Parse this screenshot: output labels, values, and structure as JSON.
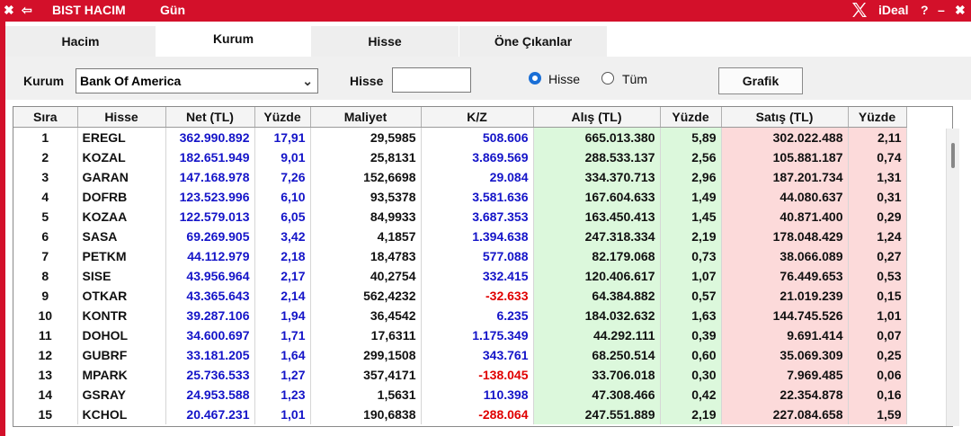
{
  "titlebar": {
    "close_glyph": "✖",
    "back_glyph": "⇦",
    "title": "BIST HACIM",
    "subtitle": "Gün",
    "brand": "iDeal",
    "help": "?",
    "minimize": "–",
    "close_right": "✖"
  },
  "tabs": [
    {
      "label": "Hacim",
      "active": false
    },
    {
      "label": "Kurum",
      "active": true
    },
    {
      "label": "Hisse",
      "active": false
    },
    {
      "label": "Öne Çıkanlar",
      "active": false
    }
  ],
  "toolbar": {
    "kurum_label": "Kurum",
    "kurum_value": "Bank Of America",
    "hisse_label": "Hisse",
    "hisse_value": "",
    "radio_hisse": "Hisse",
    "radio_tum": "Tüm",
    "selected_radio": "Hisse",
    "grafik_button": "Grafik"
  },
  "table": {
    "columns": [
      "Sıra",
      "Hisse",
      "Net (TL)",
      "Yüzde",
      "Maliyet",
      "K/Z",
      "Alış (TL)",
      "Yüzde",
      "Satış (TL)",
      "Yüzde"
    ],
    "rows": [
      [
        "1",
        "EREGL",
        "362.990.892",
        "17,91",
        "29,5985",
        "508.606",
        "665.013.380",
        "5,89",
        "302.022.488",
        "2,11"
      ],
      [
        "2",
        "KOZAL",
        "182.651.949",
        "9,01",
        "25,8131",
        "3.869.569",
        "288.533.137",
        "2,56",
        "105.881.187",
        "0,74"
      ],
      [
        "3",
        "GARAN",
        "147.168.978",
        "7,26",
        "152,6698",
        "29.084",
        "334.370.713",
        "2,96",
        "187.201.734",
        "1,31"
      ],
      [
        "4",
        "DOFRB",
        "123.523.996",
        "6,10",
        "93,5378",
        "3.581.636",
        "167.604.633",
        "1,49",
        "44.080.637",
        "0,31"
      ],
      [
        "5",
        "KOZAA",
        "122.579.013",
        "6,05",
        "84,9933",
        "3.687.353",
        "163.450.413",
        "1,45",
        "40.871.400",
        "0,29"
      ],
      [
        "6",
        "SASA",
        "69.269.905",
        "3,42",
        "4,1857",
        "1.394.638",
        "247.318.334",
        "2,19",
        "178.048.429",
        "1,24"
      ],
      [
        "7",
        "PETKM",
        "44.112.979",
        "2,18",
        "18,4783",
        "577.088",
        "82.179.068",
        "0,73",
        "38.066.089",
        "0,27"
      ],
      [
        "8",
        "SISE",
        "43.956.964",
        "2,17",
        "40,2754",
        "332.415",
        "120.406.617",
        "1,07",
        "76.449.653",
        "0,53"
      ],
      [
        "9",
        "OTKAR",
        "43.365.643",
        "2,14",
        "562,4232",
        "-32.633",
        "64.384.882",
        "0,57",
        "21.019.239",
        "0,15"
      ],
      [
        "10",
        "KONTR",
        "39.287.106",
        "1,94",
        "36,4542",
        "6.235",
        "184.032.632",
        "1,63",
        "144.745.526",
        "1,01"
      ],
      [
        "11",
        "DOHOL",
        "34.600.697",
        "1,71",
        "17,6311",
        "1.175.349",
        "44.292.111",
        "0,39",
        "9.691.414",
        "0,07"
      ],
      [
        "12",
        "GUBRF",
        "33.181.205",
        "1,64",
        "299,1508",
        "343.761",
        "68.250.514",
        "0,60",
        "35.069.309",
        "0,25"
      ],
      [
        "13",
        "MPARK",
        "25.736.533",
        "1,27",
        "357,4171",
        "-138.045",
        "33.706.018",
        "0,30",
        "7.969.485",
        "0,06"
      ],
      [
        "14",
        "GSRAY",
        "24.953.588",
        "1,23",
        "1,5631",
        "110.398",
        "47.308.466",
        "0,42",
        "22.354.878",
        "0,16"
      ],
      [
        "15",
        "KCHOL",
        "20.467.231",
        "1,01",
        "190,6838",
        "-288.064",
        "247.551.889",
        "2,19",
        "227.084.658",
        "1,59"
      ]
    ]
  },
  "colors": {
    "frame": "#d3102a",
    "net_text": "#1414c8",
    "kz_positive": "#1414c8",
    "kz_negative": "#e00000",
    "buy_bg": "#dcf8dc",
    "sell_bg": "#fcdada"
  }
}
